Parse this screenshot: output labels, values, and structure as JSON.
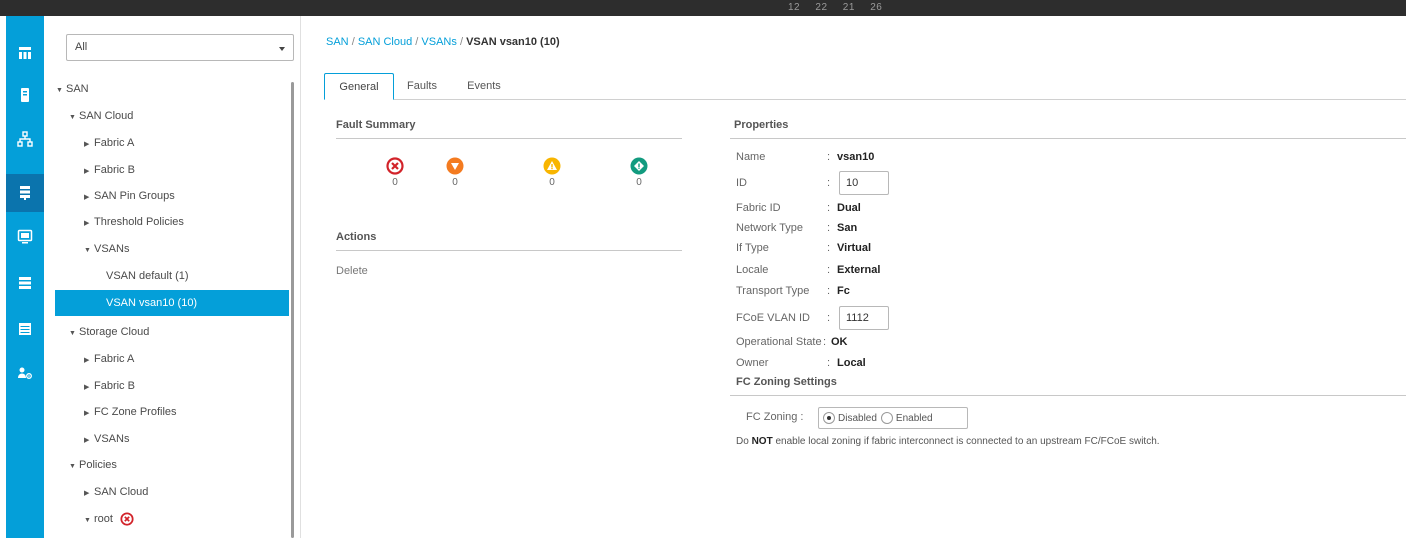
{
  "topbar": {
    "numbers": "12 22 21 26"
  },
  "nav": {
    "icons": [
      "equipment-icon",
      "servers-icon",
      "lan-icon",
      "san-icon",
      "vm-icon",
      "storage-icon",
      "chassis-icon",
      "admin-icon"
    ],
    "active": "san-icon"
  },
  "tree": {
    "filter": {
      "value": "All"
    },
    "nodes": [
      {
        "label": "SAN",
        "expanded": true
      },
      {
        "label": "SAN Cloud",
        "expanded": true
      },
      {
        "label": "Fabric A"
      },
      {
        "label": "Fabric B"
      },
      {
        "label": "SAN Pin Groups"
      },
      {
        "label": "Threshold Policies"
      },
      {
        "label": "VSANs",
        "expanded": true
      },
      {
        "label": "VSAN default (1)"
      },
      {
        "label": "VSAN vsan10 (10)",
        "selected": true
      },
      {
        "label": "Storage Cloud",
        "expanded": true
      },
      {
        "label": "Fabric A"
      },
      {
        "label": "Fabric B"
      },
      {
        "label": "FC Zone Profiles"
      },
      {
        "label": "VSANs"
      },
      {
        "label": "Policies",
        "expanded": true
      },
      {
        "label": "SAN Cloud"
      },
      {
        "label": "root",
        "expanded": true,
        "status_icon": "error-icon"
      }
    ]
  },
  "breadcrumb": {
    "items": [
      "SAN",
      "SAN Cloud",
      "VSANs"
    ],
    "separator": "/",
    "current": "VSAN vsan10 (10)"
  },
  "tabs": [
    {
      "label": "General",
      "active": true
    },
    {
      "label": "Faults"
    },
    {
      "label": "Events"
    }
  ],
  "fault_summary": {
    "title": "Fault Summary",
    "items": [
      {
        "severity": "critical",
        "icon": "critical-fault-icon",
        "color": "#d2232a",
        "count": "0"
      },
      {
        "severity": "major",
        "icon": "major-fault-icon",
        "color": "#f47b20",
        "count": "0"
      },
      {
        "severity": "minor",
        "icon": "minor-fault-icon",
        "color": "#f8b500",
        "count": "0"
      },
      {
        "severity": "warning",
        "icon": "warning-fault-icon",
        "color": "#129b7f",
        "count": "0"
      }
    ]
  },
  "actions": {
    "title": "Actions",
    "items": [
      "Delete"
    ]
  },
  "properties": {
    "title": "Properties",
    "name": {
      "label": "Name",
      "value": "vsan10"
    },
    "id": {
      "label": "ID",
      "value": "10"
    },
    "fabric_id": {
      "label": "Fabric ID",
      "value": "Dual"
    },
    "network_type": {
      "label": "Network Type",
      "value": "San"
    },
    "if_type": {
      "label": "If Type",
      "value": "Virtual"
    },
    "locale": {
      "label": "Locale",
      "value": "External"
    },
    "transport_type": {
      "label": "Transport Type",
      "value": "Fc"
    },
    "fcoe_vlan_id": {
      "label": "FCoE VLAN ID",
      "value": "1112"
    },
    "operational_state": {
      "label": "Operational State",
      "value": "OK"
    },
    "owner": {
      "label": "Owner",
      "value": "Local"
    },
    "colon": ":"
  },
  "fc_zoning": {
    "title": "FC Zoning Settings",
    "label": "FC Zoning :",
    "options": [
      "Disabled",
      "Enabled"
    ],
    "selected": "Disabled",
    "note_prefix": "Do",
    "note_bold": "NOT",
    "note_suffix": "enable local zoning if fabric interconnect is connected to an upstream FC/FCoE switch."
  },
  "colors": {
    "accent": "#049fd9",
    "nav_active": "#0b74ad",
    "topbar": "#2d2d2d"
  }
}
